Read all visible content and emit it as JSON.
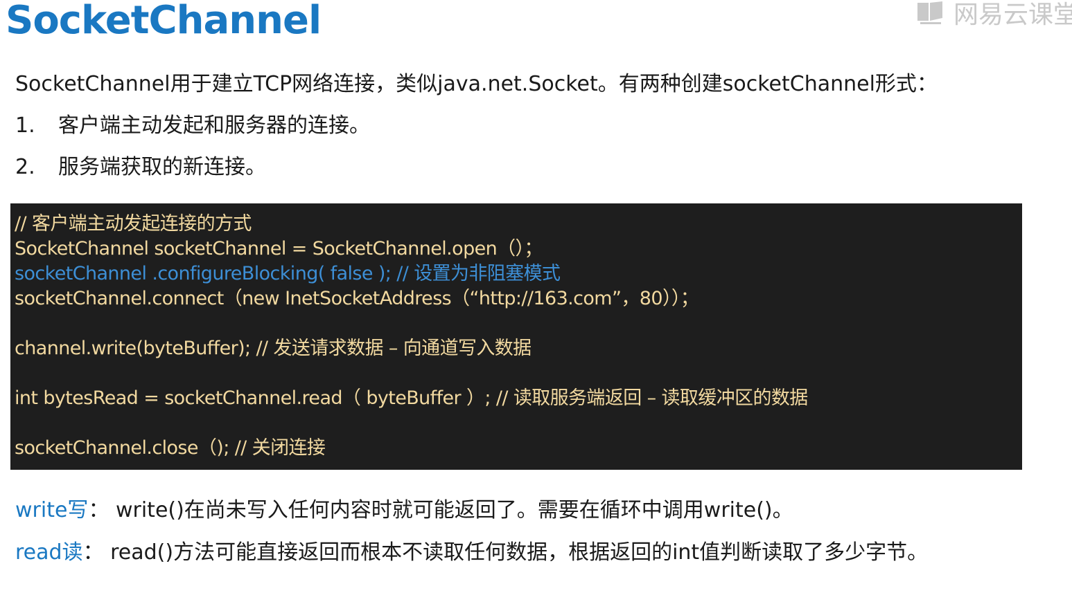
{
  "title": "SocketChannel",
  "watermark": {
    "text": "网易云课堂",
    "icon": "book-logo-icon",
    "color": "#c9c9c9"
  },
  "intro": "SocketChannel用于建立TCP网络连接，类似java.net.Socket。有两种创建socketChannel形式：",
  "list": [
    {
      "num": "1.",
      "text": "客户端主动发起和服务器的连接。"
    },
    {
      "num": "2.",
      "text": "服务端获取的新连接。"
    }
  ],
  "code": {
    "background": "#1e1e1e",
    "text_color": "#f2d9a0",
    "highlight_color": "#3d8fd6",
    "lines": [
      "// 客户端主动发起连接的方式",
      "SocketChannel socketChannel = SocketChannel.open（）；",
      "socketChannel .configureBlocking( false ); // 设置为非阻塞模式",
      "socketChannel.connect（new InetSocketAddress（“http://163.com”，80））；",
      "channel.write(byteBuffer); //  发送请求数据 – 向通道写入数据",
      "int bytesRead = socketChannel.read（ byteBuffer ）; // 读取服务端返回 – 读取缓冲区的数据",
      "socketChannel.close（); // 关闭连接"
    ]
  },
  "notes": {
    "write_key": "write写",
    "write_text": "：  write()在尚未写入任何内容时就可能返回了。需要在循环中调用write()。",
    "read_key": "read读",
    "read_text": "：  read()方法可能直接返回而根本不读取任何数据，根据返回的int值判断读取了多少字节。"
  },
  "colors": {
    "title": "#1a78c2",
    "body_text": "#1a1a1a"
  }
}
